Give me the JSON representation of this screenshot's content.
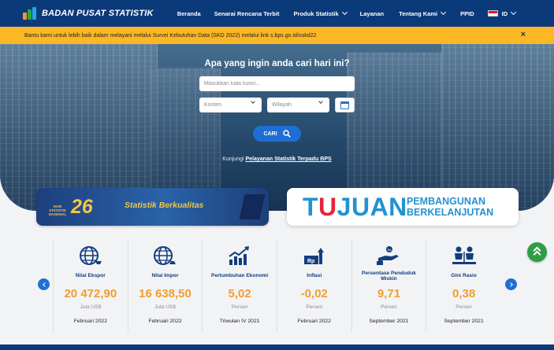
{
  "navbar": {
    "logo_text": "BADAN PUSAT STATISTIK",
    "menu": [
      {
        "label": "Beranda"
      },
      {
        "label": "Senarai Rencana Terbit"
      },
      {
        "label": "Produk Statistik"
      },
      {
        "label": "Layanan"
      },
      {
        "label": "Tentang Kami"
      },
      {
        "label": "PPID"
      }
    ],
    "language": "ID"
  },
  "announcement": {
    "text": "Bantu kami untuk lebih baik dalam melayani melalui Survei Kebutuhan Data (SKD 2022) melalui link s.bps.go.id/oskd22",
    "close": "×"
  },
  "hero": {
    "title": "Apa yang ingin anda cari hari ini?",
    "search_placeholder": "Masukkan kata kunci...",
    "content_select": "Konten",
    "region_select": "Wilayah",
    "search_button": "CARI",
    "visit_prefix": "Kunjungi",
    "visit_link": "Pelayanan Statistik Terpadu BPS"
  },
  "banners": {
    "left": {
      "badge_small": "HARI STATISTIK NASIONAL",
      "badge_number": "26",
      "title": "Statistik Berkualitas"
    },
    "right": {
      "big_prefix": "T",
      "big_highlight": "U",
      "big_suffix": "JUAN",
      "line1": "PEMBANGUNAN",
      "line2": "BERKELANJUTAN"
    }
  },
  "indicators": [
    {
      "label": "Nilai Ekspor",
      "value": "20 472,90",
      "unit": "Juta US$",
      "date": "Februari 2022",
      "icon": "globe-icon"
    },
    {
      "label": "Nilai Impor",
      "value": "16 638,50",
      "unit": "Juta US$",
      "date": "Februari 2022",
      "icon": "globe-icon"
    },
    {
      "label": "Pertumbuhan Ekonomi",
      "value": "5,02",
      "unit": "Persen",
      "date": "Triwulan IV 2021",
      "icon": "growth-chart-icon"
    },
    {
      "label": "Inflasi",
      "value": "-0,02",
      "unit": "Persen",
      "date": "Februari 2022",
      "icon": "inflation-icon"
    },
    {
      "label": "Persentase Penduduk Miskin",
      "value": "9,71",
      "unit": "Persen",
      "date": "September 2021",
      "icon": "poverty-hand-icon"
    },
    {
      "label": "Gini Rasio",
      "value": "0,38",
      "unit": "Persen",
      "date": "September 2021",
      "icon": "people-icon"
    }
  ],
  "colors": {
    "navy": "#0b3a7a",
    "yellow": "#fbb824",
    "orange_value": "#f19e2d",
    "blue_button": "#1d6fd3",
    "green_scroll": "#2e9e45"
  }
}
